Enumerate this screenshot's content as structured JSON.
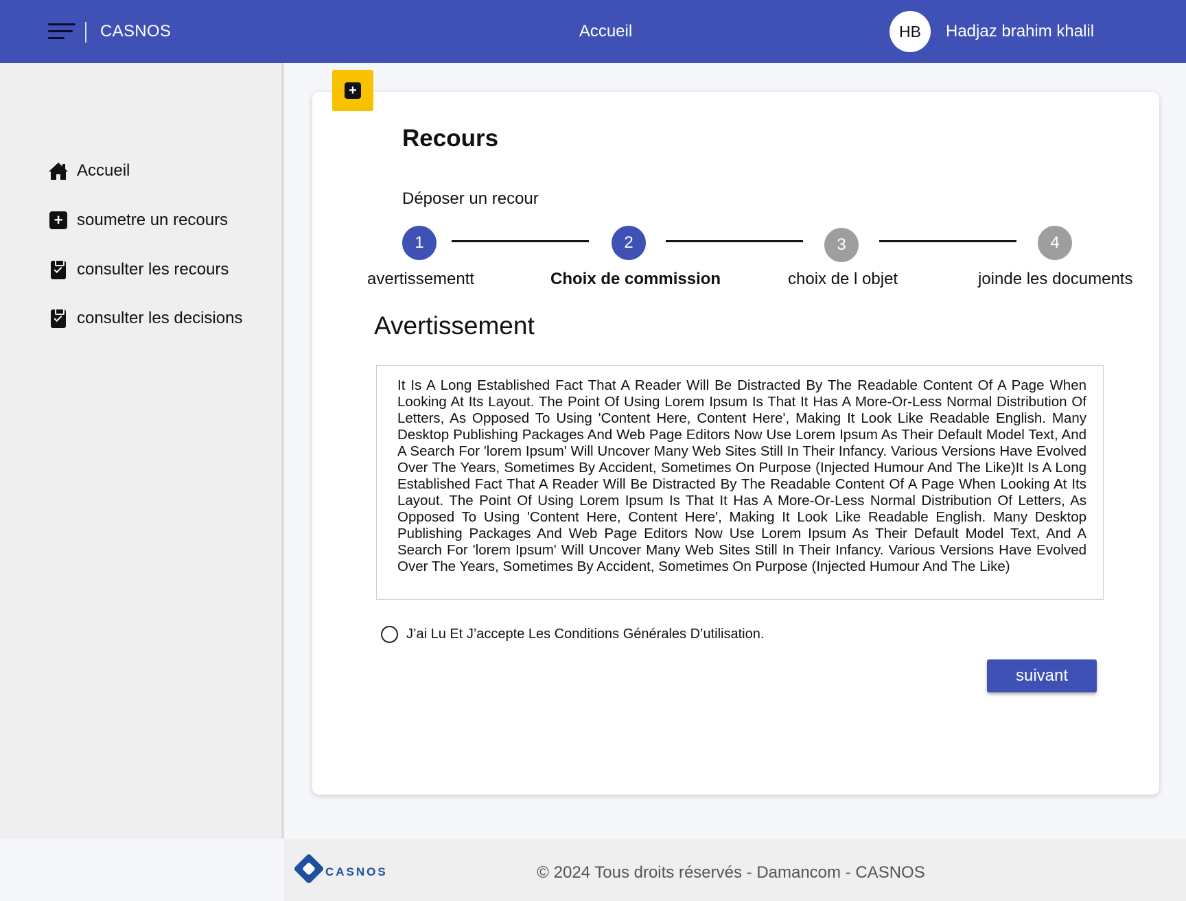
{
  "header": {
    "app_title": "CASNOS",
    "page_title": "Accueil",
    "avatar_initials": "HB",
    "user_name": "Hadjaz brahim khalil"
  },
  "sidebar": {
    "items": [
      {
        "label": "Accueil",
        "icon": "home-icon"
      },
      {
        "label": "soumetre un recours",
        "icon": "plus-square-icon"
      },
      {
        "label": "consulter les recours",
        "icon": "clipboard-check-icon"
      },
      {
        "label": "consulter les decisions",
        "icon": "clipboard-check-icon"
      }
    ]
  },
  "main": {
    "title": "Recours",
    "subtitle": "Déposer un recour",
    "steps": [
      {
        "number": "1",
        "label": "avertissementt",
        "state": "active"
      },
      {
        "number": "2",
        "label": "Choix de commission",
        "state": "active"
      },
      {
        "number": "3",
        "label": "choix de l objet",
        "state": "inactive"
      },
      {
        "number": "4",
        "label": "joinde les documents",
        "state": "inactive"
      }
    ],
    "section_title": "Avertissement",
    "warning_text": "It Is A Long Established Fact That A Reader Will Be Distracted By The Readable Content Of A Page When Looking At Its Layout. The Point Of Using Lorem Ipsum Is That It Has A More-Or-Less Normal Distribution Of Letters, As Opposed To Using 'Content Here, Content Here', Making It Look Like Readable English. Many Desktop Publishing Packages And Web Page Editors Now Use Lorem Ipsum As Their Default Model Text, And A Search For 'lorem Ipsum' Will Uncover Many Web Sites Still In Their Infancy. Various Versions Have Evolved Over The Years, Sometimes By Accident, Sometimes On Purpose (Injected Humour And The Like)It Is A Long Established Fact That A Reader Will Be Distracted By The Readable Content Of A Page When Looking At Its Layout. The Point Of Using Lorem Ipsum Is That It Has A More-Or-Less Normal Distribution Of Letters, As Opposed To Using 'Content Here, Content Here', Making It Look Like Readable English. Many Desktop Publishing Packages And Web Page Editors Now Use Lorem Ipsum As Their Default Model Text, And A Search For 'lorem Ipsum' Will Uncover Many Web Sites Still In Their Infancy. Various Versions Have Evolved Over The Years, Sometimes By Accident, Sometimes On Purpose (Injected Humour And The Like)",
    "accept_label": "J’ai Lu Et J’accepte Les Conditions Générales D’utilisation.",
    "next_button": "suivant"
  },
  "footer": {
    "logo_text": "CASNOS",
    "copyright": "© 2024 Tous droits réservés - Damancom - CASNOS"
  },
  "colors": {
    "primary": "#3f51b5",
    "accent": "#f9c200",
    "inactive_step": "#9e9e9e"
  }
}
